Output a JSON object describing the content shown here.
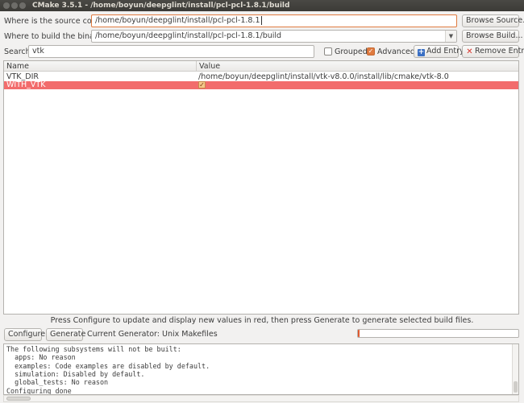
{
  "window": {
    "title": "CMake 3.5.1 - /home/boyun/deepglint/install/pcl-pcl-1.8.1/build"
  },
  "source": {
    "label": "Where is the source code:",
    "value": "/home/boyun/deepglint/install/pcl-pcl-1.8.1",
    "browse_label": "Browse Source..."
  },
  "build": {
    "label": "Where to build the binaries:",
    "value": "/home/boyun/deepglint/install/pcl-pcl-1.8.1/build",
    "browse_label": "Browse Build..."
  },
  "search": {
    "label": "Search:",
    "value": "vtk"
  },
  "options": {
    "grouped_label": "Grouped",
    "grouped_checked": false,
    "advanced_label": "Advanced",
    "advanced_checked": true,
    "add_entry_label": "Add Entry",
    "remove_entry_label": "Remove Entry"
  },
  "table": {
    "columns": [
      "Name",
      "Value"
    ],
    "rows": [
      {
        "name": "VTK_DIR",
        "value": "/home/boyun/deepglint/install/vtk-v8.0.0/install/lib/cmake/vtk-8.0",
        "selected": false,
        "highlight_color": ""
      },
      {
        "name": "WITH_VTK",
        "value": "✓",
        "selected": true,
        "highlight_color": "#f26c6c"
      }
    ]
  },
  "status_message": "Press Configure to update and display new values in red, then press Generate to generate selected build files.",
  "actions": {
    "configure_label": "Configure",
    "generate_label": "Generate",
    "generator_text": "Current Generator: Unix Makefiles"
  },
  "progress": {
    "fraction": 0.01,
    "color": "#e05a30"
  },
  "output": {
    "lines": [
      "The following subsystems will not be built:",
      "  apps: No reason",
      "  examples: Code examples are disabled by default.",
      "  simulation: Disabled by default.",
      "  global_tests: No reason",
      "Configuring done"
    ]
  },
  "colors": {
    "accent": "#e07a3f",
    "selected_row": "#f26c6c"
  }
}
